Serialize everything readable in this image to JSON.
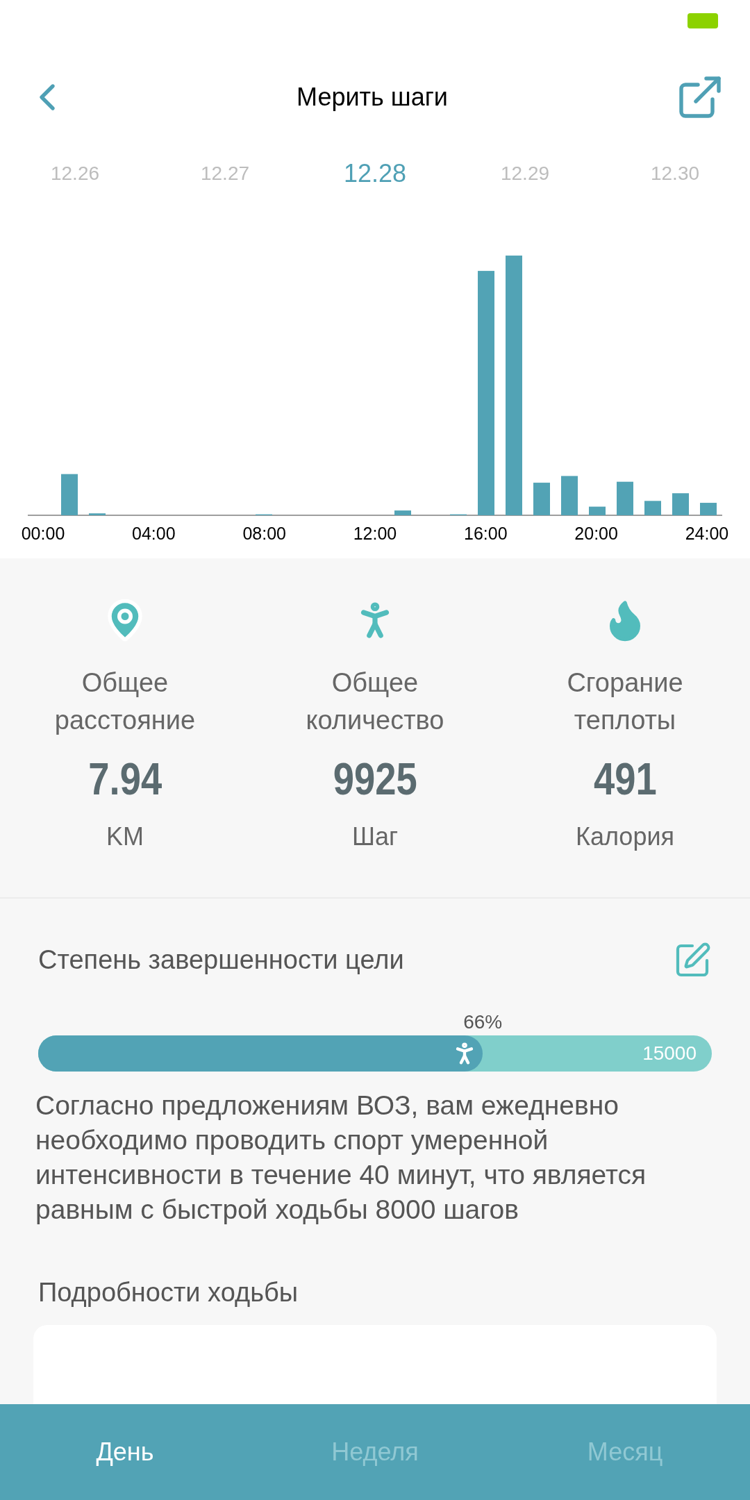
{
  "header": {
    "title": "Мерить шаги"
  },
  "dates": [
    {
      "label": "12.26",
      "selected": false
    },
    {
      "label": "12.27",
      "selected": false
    },
    {
      "label": "12.28",
      "selected": true
    },
    {
      "label": "12.29",
      "selected": false
    },
    {
      "label": "12.30",
      "selected": false
    }
  ],
  "chart": {
    "x_labels": [
      "00:00",
      "04:00",
      "08:00",
      "12:00",
      "16:00",
      "20:00",
      "24:00"
    ]
  },
  "stats": [
    {
      "kind": "distance",
      "label": "Общее расстояние",
      "value": "7.94",
      "unit": "KM"
    },
    {
      "kind": "steps",
      "label": "Общее количество",
      "value": "9925",
      "unit": "Шаг"
    },
    {
      "kind": "calories",
      "label": "Сгорание теплоты",
      "value": "491",
      "unit": "Калория"
    }
  ],
  "goal": {
    "title": "Степень завершенности цели",
    "percent": "66%",
    "level": 0.66,
    "target": "15000",
    "advice": "Согласно предложениям ВОЗ, вам ежедневно необходимо проводить спорт умеренной интенсивности в течение 40 минут, что является равным с быстрой ходьбы 8000 шагов"
  },
  "details": {
    "title": "Подробности ходьбы"
  },
  "bottom_tabs": [
    {
      "label": "День",
      "selected": true
    },
    {
      "label": "Неделя",
      "selected": false
    },
    {
      "label": "Месяц",
      "selected": false
    }
  ]
}
